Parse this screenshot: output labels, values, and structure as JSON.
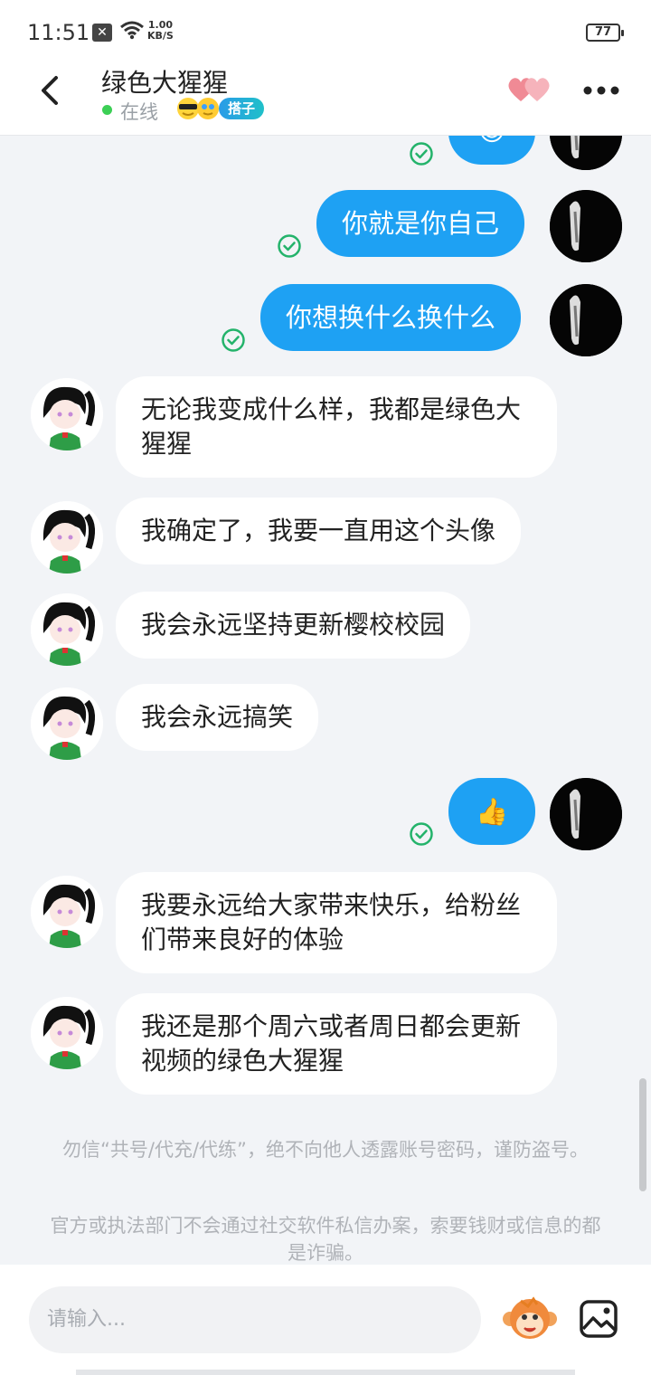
{
  "status_bar": {
    "time": "11:51",
    "network_speed_value": "1.00",
    "network_speed_unit": "KB/S",
    "battery": "77"
  },
  "header": {
    "title": "绿色大猩猩",
    "presence": "在线",
    "tag": "搭子"
  },
  "messages": [
    {
      "from": "me",
      "type": "emoji",
      "text": "😌",
      "read": true
    },
    {
      "from": "me",
      "type": "text",
      "text": "你就是你自己",
      "read": true
    },
    {
      "from": "me",
      "type": "text",
      "text": "你想换什么换什么",
      "read": true
    },
    {
      "from": "other",
      "type": "text",
      "text": "无论我变成什么样，我都是绿色大猩猩"
    },
    {
      "from": "other",
      "type": "text",
      "text": "我确定了，我要一直用这个头像"
    },
    {
      "from": "other",
      "type": "text",
      "text": "我会永远坚持更新樱校校园"
    },
    {
      "from": "other",
      "type": "text",
      "text": "我会永远搞笑"
    },
    {
      "from": "me",
      "type": "emoji",
      "text": "👍",
      "read": true
    },
    {
      "from": "other",
      "type": "text",
      "text": "我要永远给大家带来快乐，给粉丝们带来良好的体验"
    },
    {
      "from": "other",
      "type": "text",
      "text": "我还是那个周六或者周日都会更新视频的绿色大猩猩"
    }
  ],
  "notices": [
    "勿信“共号/代充/代练”，绝不向他人透露账号密码，谨防盗号。",
    "官方或执法部门不会通过社交软件私信办案，索要钱财或信息的都是诈骗。"
  ],
  "input": {
    "placeholder": "请输入..."
  },
  "icons": {
    "back": "chevron-left-icon",
    "hearts": "hearts-icon",
    "more": "more-dots-icon",
    "read": "check-circle-icon",
    "emoji_button": "monkey-emoji-icon",
    "image_button": "image-icon"
  },
  "colors": {
    "outgoing_bubble": "#1ea1f3",
    "incoming_bubble": "#ffffff",
    "background": "#f2f4f7",
    "read_check": "#24b36b",
    "online": "#3ccf55"
  }
}
